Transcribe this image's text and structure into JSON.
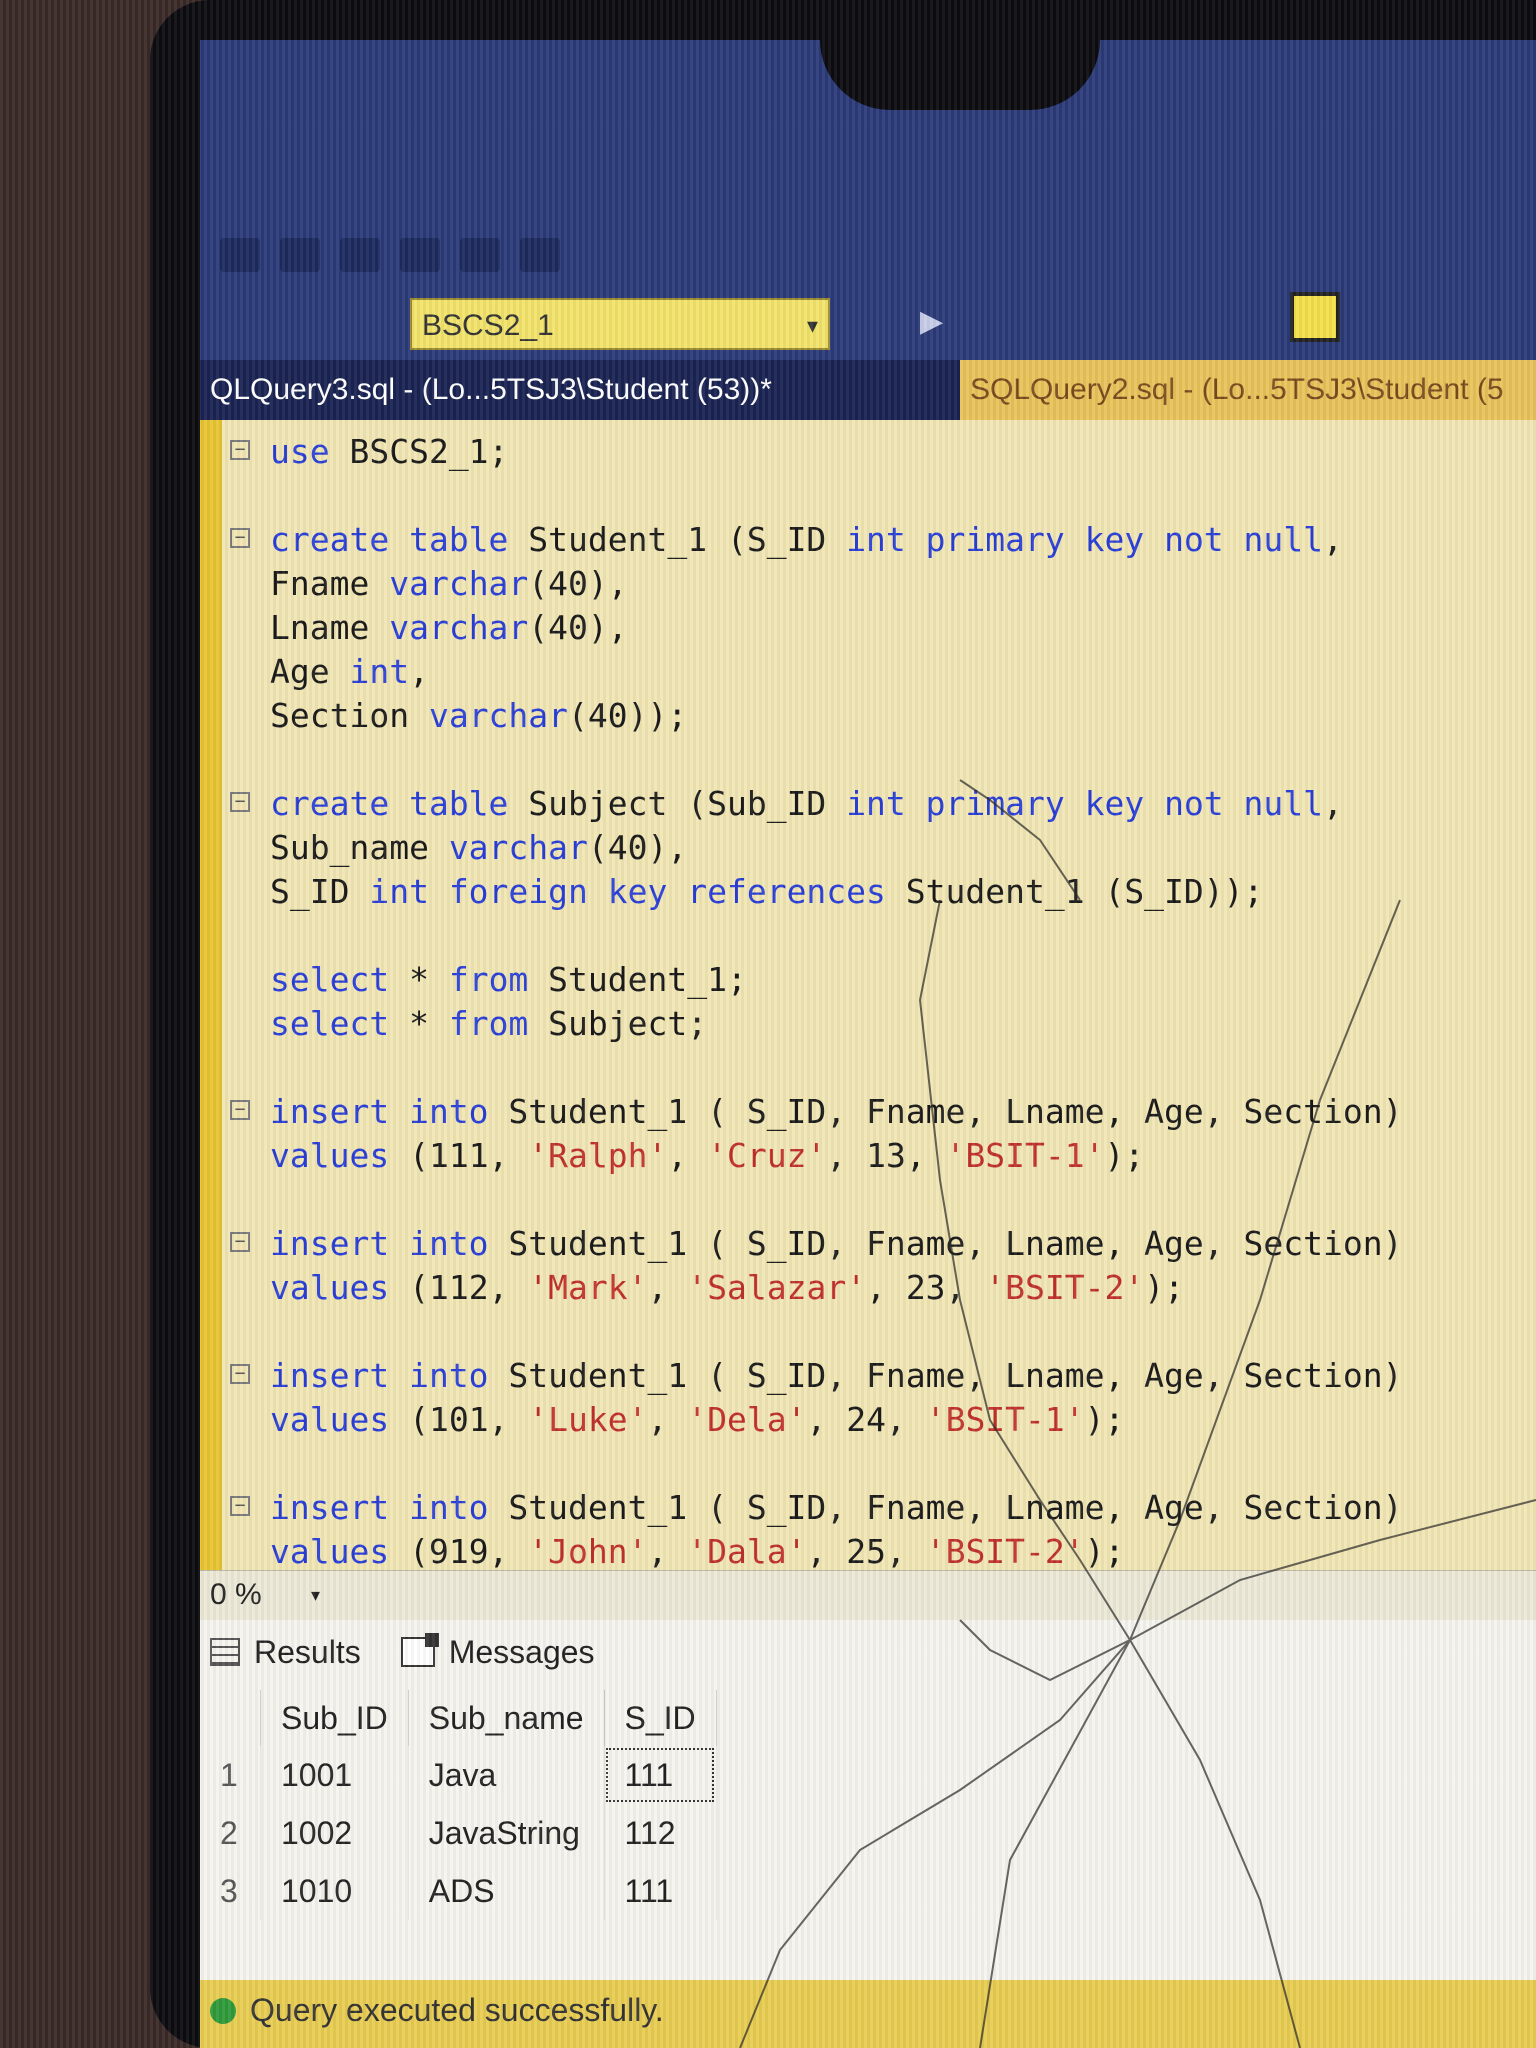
{
  "database": {
    "selected": "BSCS2_1"
  },
  "tabs": [
    {
      "label": "QLQuery3.sql - (Lo...5TSJ3\\Student (53))*"
    },
    {
      "label": "SQLQuery2.sql - (Lo...5TSJ3\\Student (5"
    }
  ],
  "zoom": "0 %",
  "results_tabs": {
    "results": "Results",
    "messages": "Messages"
  },
  "results_table": {
    "columns": [
      "Sub_ID",
      "Sub_name",
      "S_ID"
    ],
    "rows": [
      {
        "num": "1",
        "cells": [
          "1001",
          "Java",
          "111"
        ]
      },
      {
        "num": "2",
        "cells": [
          "1002",
          "JavaString",
          "112"
        ]
      },
      {
        "num": "3",
        "cells": [
          "1010",
          "ADS",
          "111"
        ]
      }
    ]
  },
  "status": {
    "text": "Query executed successfully."
  },
  "code": [
    {
      "fold": true,
      "tokens": [
        {
          "k": "kw",
          "t": "use"
        },
        {
          "k": "",
          "t": " BSCS2_1;"
        }
      ]
    },
    {
      "gap": true
    },
    {
      "fold": true,
      "tokens": [
        {
          "k": "kw",
          "t": "create table"
        },
        {
          "k": "",
          "t": " Student_1 (S_ID "
        },
        {
          "k": "kw",
          "t": "int primary key not null"
        },
        {
          "k": "",
          "t": ","
        }
      ]
    },
    {
      "tokens": [
        {
          "k": "",
          "t": "Fname "
        },
        {
          "k": "kw",
          "t": "varchar"
        },
        {
          "k": "",
          "t": "(40),"
        }
      ]
    },
    {
      "tokens": [
        {
          "k": "",
          "t": "Lname "
        },
        {
          "k": "kw",
          "t": "varchar"
        },
        {
          "k": "",
          "t": "(40),"
        }
      ]
    },
    {
      "tokens": [
        {
          "k": "",
          "t": "Age "
        },
        {
          "k": "kw",
          "t": "int"
        },
        {
          "k": "",
          "t": ","
        }
      ]
    },
    {
      "tokens": [
        {
          "k": "",
          "t": "Section "
        },
        {
          "k": "kw",
          "t": "varchar"
        },
        {
          "k": "",
          "t": "(40));"
        }
      ]
    },
    {
      "gap": true
    },
    {
      "fold": true,
      "tokens": [
        {
          "k": "kw",
          "t": "create table"
        },
        {
          "k": "",
          "t": " Subject (Sub_ID "
        },
        {
          "k": "kw",
          "t": "int primary key not null"
        },
        {
          "k": "",
          "t": ","
        }
      ]
    },
    {
      "tokens": [
        {
          "k": "",
          "t": "Sub_name "
        },
        {
          "k": "kw",
          "t": "varchar"
        },
        {
          "k": "",
          "t": "(40),"
        }
      ]
    },
    {
      "tokens": [
        {
          "k": "",
          "t": "S_ID "
        },
        {
          "k": "kw",
          "t": "int foreign key references"
        },
        {
          "k": "",
          "t": " Student_1 (S_ID));"
        }
      ]
    },
    {
      "gap": true
    },
    {
      "tokens": [
        {
          "k": "kw",
          "t": "select"
        },
        {
          "k": "",
          "t": " * "
        },
        {
          "k": "kw",
          "t": "from"
        },
        {
          "k": "",
          "t": " Student_1;"
        }
      ]
    },
    {
      "tokens": [
        {
          "k": "kw",
          "t": "select"
        },
        {
          "k": "",
          "t": " * "
        },
        {
          "k": "kw",
          "t": "from"
        },
        {
          "k": "",
          "t": " Subject;"
        }
      ]
    },
    {
      "gap": true
    },
    {
      "fold": true,
      "tokens": [
        {
          "k": "kw",
          "t": "insert into"
        },
        {
          "k": "",
          "t": " Student_1 ( S_ID, Fname, Lname, Age, Section)"
        }
      ]
    },
    {
      "tokens": [
        {
          "k": "kw",
          "t": "values"
        },
        {
          "k": "",
          "t": " (111, "
        },
        {
          "k": "str",
          "t": "'Ralph'"
        },
        {
          "k": "",
          "t": ", "
        },
        {
          "k": "str",
          "t": "'Cruz'"
        },
        {
          "k": "",
          "t": ", 13, "
        },
        {
          "k": "str",
          "t": "'BSIT-1'"
        },
        {
          "k": "",
          "t": ");"
        }
      ]
    },
    {
      "gap": true
    },
    {
      "fold": true,
      "tokens": [
        {
          "k": "kw",
          "t": "insert into"
        },
        {
          "k": "",
          "t": " Student_1 ( S_ID, Fname, Lname, Age, Section)"
        }
      ]
    },
    {
      "tokens": [
        {
          "k": "kw",
          "t": "values"
        },
        {
          "k": "",
          "t": " (112, "
        },
        {
          "k": "str",
          "t": "'Mark'"
        },
        {
          "k": "",
          "t": ", "
        },
        {
          "k": "str",
          "t": "'Salazar'"
        },
        {
          "k": "",
          "t": ", 23, "
        },
        {
          "k": "str",
          "t": "'BSIT-2'"
        },
        {
          "k": "",
          "t": ");"
        }
      ]
    },
    {
      "gap": true
    },
    {
      "fold": true,
      "tokens": [
        {
          "k": "kw",
          "t": "insert into"
        },
        {
          "k": "",
          "t": " Student_1 ( S_ID, Fname, Lname, Age, Section)"
        }
      ]
    },
    {
      "tokens": [
        {
          "k": "kw",
          "t": "values"
        },
        {
          "k": "",
          "t": " (101, "
        },
        {
          "k": "str",
          "t": "'Luke'"
        },
        {
          "k": "",
          "t": ", "
        },
        {
          "k": "str",
          "t": "'Dela'"
        },
        {
          "k": "",
          "t": ", 24, "
        },
        {
          "k": "str",
          "t": "'BSIT-1'"
        },
        {
          "k": "",
          "t": ");"
        }
      ]
    },
    {
      "gap": true
    },
    {
      "fold": true,
      "tokens": [
        {
          "k": "kw",
          "t": "insert into"
        },
        {
          "k": "",
          "t": " Student_1 ( S_ID, Fname, Lname, Age, Section)"
        }
      ]
    },
    {
      "tokens": [
        {
          "k": "kw",
          "t": "values"
        },
        {
          "k": "",
          "t": " (919, "
        },
        {
          "k": "str",
          "t": "'John'"
        },
        {
          "k": "",
          "t": ", "
        },
        {
          "k": "str",
          "t": "'Dala'"
        },
        {
          "k": "",
          "t": ", 25, "
        },
        {
          "k": "str",
          "t": "'BSIT-2'"
        },
        {
          "k": "",
          "t": ");"
        }
      ]
    }
  ]
}
